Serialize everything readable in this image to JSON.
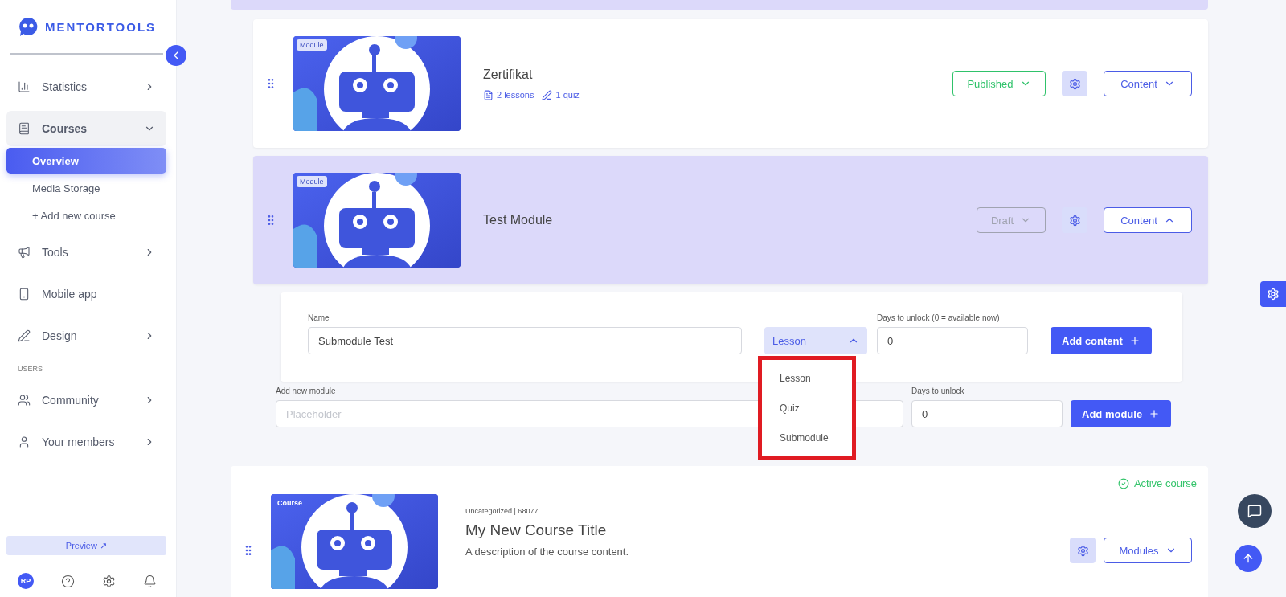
{
  "sidebar": {
    "logo": "MENTORTOOLS",
    "items": [
      {
        "kind": "statistics",
        "label": "Statistics",
        "expanded": false
      },
      {
        "kind": "courses",
        "label": "Courses",
        "expanded": true,
        "children": [
          {
            "label": "Overview",
            "selected": true
          },
          {
            "label": "Media Storage",
            "selected": false
          },
          {
            "label": "+ Add new course",
            "selected": false
          }
        ]
      },
      {
        "kind": "tools",
        "label": "Tools",
        "expanded": false
      },
      {
        "kind": "mobile",
        "label": "Mobile app"
      },
      {
        "kind": "design",
        "label": "Design",
        "expanded": false
      },
      {
        "kind": "section",
        "label": "USERS"
      },
      {
        "kind": "community",
        "label": "Community",
        "expanded": false
      },
      {
        "kind": "members",
        "label": "Your members",
        "expanded": false
      }
    ],
    "preview": "Preview ↗",
    "avatar": "RP"
  },
  "modules": [
    {
      "badge": "Module",
      "title": "Zertifikat",
      "highlighted": false,
      "stats": [
        {
          "kind": "lessons",
          "text": "2 lessons"
        },
        {
          "kind": "quiz",
          "text": "1 quiz"
        }
      ],
      "status": {
        "kind": "published",
        "label": "Published"
      },
      "content": {
        "label": "Content",
        "expanded": false
      }
    },
    {
      "badge": "Module",
      "title": "Test Module",
      "highlighted": true,
      "status": {
        "kind": "draft",
        "label": "Draft"
      },
      "content": {
        "label": "Content",
        "expanded": true
      }
    }
  ],
  "content_form": {
    "name_label": "Name",
    "name_value": "Submodule Test",
    "type": {
      "value": "Lesson",
      "expanded": true,
      "options": [
        {
          "label": "Lesson"
        },
        {
          "label": "Quiz"
        },
        {
          "label": "Submodule"
        }
      ]
    },
    "days_label": "Days to unlock (0 = available now)",
    "days_value": "0",
    "button": "Add content"
  },
  "add_module": {
    "label": "Add new module",
    "placeholder": "Placeholder",
    "days_label": "Days to unlock",
    "days_value": "0",
    "button": "Add module"
  },
  "course": {
    "badge": "Course",
    "status": "Active course",
    "meta": "Uncategorized | 68077",
    "title": "My New Course Title",
    "description": "A description of the course content.",
    "button": "Modules",
    "expanded": false
  }
}
